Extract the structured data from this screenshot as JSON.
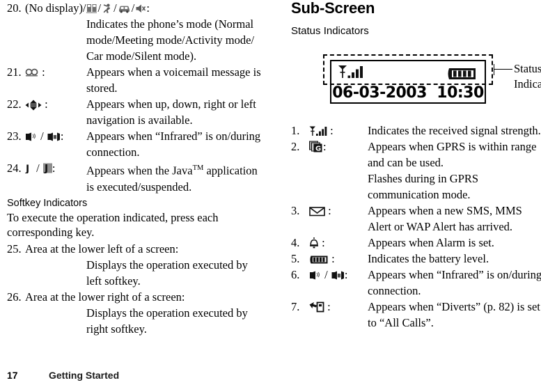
{
  "footer": {
    "page_number": "17",
    "chapter": "Getting Started",
    "chapter_color": "#1a1a1a"
  },
  "left_column": {
    "main_screen_items": [
      {
        "number": "20.",
        "key_text": "(No display)/",
        "key_icons": [
          "meeting-mode-icon",
          "activity-mode-icon",
          "car-mode-icon",
          "silent-mode-icon"
        ],
        "colon": ":",
        "inline_key": true,
        "description_lines": [
          "Indicates the phone’s mode (Normal",
          "mode/Meeting mode/Activity mode/",
          "Car mode/Silent mode)."
        ]
      },
      {
        "number": "21.",
        "key_icons": [
          "voicemail-icon"
        ],
        "colon": ":",
        "description_lines": [
          "Appears when a voicemail message is",
          "stored."
        ]
      },
      {
        "number": "22.",
        "key_icons": [
          "navigation-arrows-icon"
        ],
        "colon": ":",
        "description_lines": [
          "Appears when up, down, right or left",
          "navigation is available."
        ]
      },
      {
        "number": "23.",
        "key_icons": [
          "infrared-on-icon",
          "infrared-connecting-icon"
        ],
        "colon": ":",
        "description_lines": [
          "Appears when “Infrared” is on/during",
          "connection."
        ]
      },
      {
        "number": "24.",
        "key_icons": [
          "java-executing-icon",
          "java-suspended-icon"
        ],
        "colon": ":",
        "description_lines": [
          "Appears when the Java",
          "is executed/suspended."
        ],
        "description_suffix_sup": "TM",
        "description_suffix": " application"
      }
    ],
    "softkey_section": {
      "heading": "Softkey Indicators",
      "intro_lines": [
        "To execute the operation indicated, press each",
        "corresponding key."
      ],
      "items": [
        {
          "number": "25.",
          "title": "Area at the lower left of a screen:",
          "description_lines": [
            "Displays the operation executed by",
            "left softkey."
          ]
        },
        {
          "number": "26.",
          "title": "Area at the lower right of a screen:",
          "description_lines": [
            "Displays the operation executed by",
            "right softkey."
          ]
        }
      ]
    }
  },
  "right_column": {
    "heading": "Sub-Screen",
    "subheading": "Status Indicators",
    "figure": {
      "date": "06-03-2003",
      "time": "10:30",
      "signal_icon": "signal-strength-icon",
      "battery_icon": "battery-full-icon",
      "callout_lines": [
        "Status",
        "Indicators"
      ]
    },
    "items": [
      {
        "number": "1.",
        "key_icons": [
          "signal-strength-icon"
        ],
        "colon": ":",
        "description_lines": [
          "Indicates the received signal strength."
        ]
      },
      {
        "number": "2.",
        "key_icons": [
          "gprs-icon"
        ],
        "colon": ":",
        "description_lines": [
          "Appears when GPRS is within range",
          "and can be used.",
          "Flashes during in GPRS",
          "communication mode."
        ]
      },
      {
        "number": "3.",
        "key_icons": [
          "envelope-icon"
        ],
        "colon": ":",
        "description_lines": [
          "Appears when a new SMS, MMS",
          "Alert or WAP Alert has arrived."
        ]
      },
      {
        "number": "4.",
        "key_icons": [
          "alarm-bell-icon"
        ],
        "colon": ":",
        "description_lines": [
          "Appears when Alarm is set."
        ]
      },
      {
        "number": "5.",
        "key_icons": [
          "battery-full-icon"
        ],
        "colon": ":",
        "description_lines": [
          "Indicates the battery level."
        ]
      },
      {
        "number": "6.",
        "key_icons": [
          "infrared-on-icon",
          "infrared-connecting-icon"
        ],
        "colon": ":",
        "description_lines": [
          "Appears when “Infrared” is on/during",
          "connection."
        ]
      },
      {
        "number": "7.",
        "key_icons": [
          "call-divert-icon"
        ],
        "colon": ":",
        "description_lines": [
          "Appears when “Diverts” (p. 82) is set",
          "to “All Calls”."
        ]
      }
    ]
  }
}
